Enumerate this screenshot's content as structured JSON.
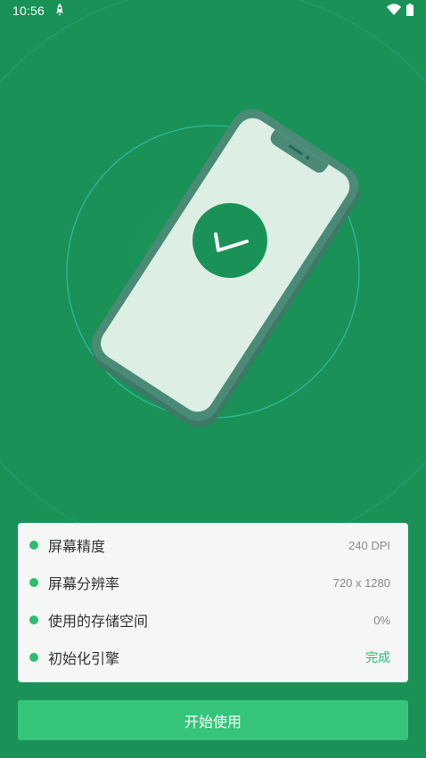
{
  "status_bar": {
    "time": "10:56",
    "icons": [
      "rocket-icon",
      "wifi-icon",
      "battery-icon"
    ]
  },
  "hero": {
    "illustration": "phone-with-checkmark",
    "icons": [
      "phone-icon",
      "check-icon"
    ]
  },
  "info": {
    "items": [
      {
        "label": "屏幕精度",
        "value": "240 DPI"
      },
      {
        "label": "屏幕分辨率",
        "value": "720 x 1280"
      },
      {
        "label": "使用的存储空间",
        "value": "0%"
      },
      {
        "label": "初始化引擎",
        "value": "完成"
      }
    ]
  },
  "actions": {
    "start_label": "开始使用"
  },
  "colors": {
    "background": "#1a9257",
    "accent": "#35c47a",
    "status_done": "#2dbb6d",
    "card": "#f5f7f6"
  }
}
